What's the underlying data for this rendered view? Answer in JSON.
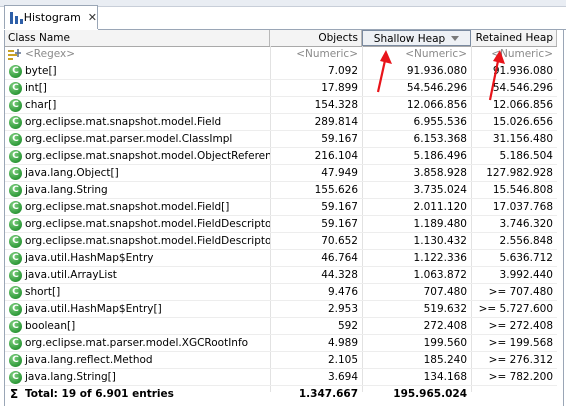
{
  "tab": {
    "title": "Histogram",
    "close": "✕"
  },
  "columns": {
    "class_name": "Class Name",
    "objects": "Objects",
    "shallow_heap": "Shallow Heap",
    "retained_heap": "Retained Heap"
  },
  "filter": {
    "regex": "<Regex>",
    "numeric1": "<Numeric>",
    "numeric2": "<Numeric>",
    "numeric3": "<Numeric>"
  },
  "rows": [
    {
      "name": "byte[]",
      "objects": "7.092",
      "shallow": "91.936.080",
      "retained": "91.936.080"
    },
    {
      "name": "int[]",
      "objects": "17.899",
      "shallow": "54.546.296",
      "retained": "54.546.296"
    },
    {
      "name": "char[]",
      "objects": "154.328",
      "shallow": "12.066.856",
      "retained": "12.066.856"
    },
    {
      "name": "org.eclipse.mat.snapshot.model.Field",
      "objects": "289.814",
      "shallow": "6.955.536",
      "retained": "15.026.656"
    },
    {
      "name": "org.eclipse.mat.parser.model.ClassImpl",
      "objects": "59.167",
      "shallow": "6.153.368",
      "retained": "31.156.480"
    },
    {
      "name": "org.eclipse.mat.snapshot.model.ObjectReference",
      "objects": "216.104",
      "shallow": "5.186.496",
      "retained": "5.186.504"
    },
    {
      "name": "java.lang.Object[]",
      "objects": "47.949",
      "shallow": "3.858.928",
      "retained": "127.982.928"
    },
    {
      "name": "java.lang.String",
      "objects": "155.626",
      "shallow": "3.735.024",
      "retained": "15.546.808"
    },
    {
      "name": "org.eclipse.mat.snapshot.model.Field[]",
      "objects": "59.167",
      "shallow": "2.011.120",
      "retained": "17.037.768"
    },
    {
      "name": "org.eclipse.mat.snapshot.model.FieldDescriptor[]",
      "objects": "59.167",
      "shallow": "1.189.480",
      "retained": "3.746.320"
    },
    {
      "name": "org.eclipse.mat.snapshot.model.FieldDescriptor",
      "objects": "70.652",
      "shallow": "1.130.432",
      "retained": "2.556.848"
    },
    {
      "name": "java.util.HashMap$Entry",
      "objects": "46.764",
      "shallow": "1.122.336",
      "retained": "5.636.712"
    },
    {
      "name": "java.util.ArrayList",
      "objects": "44.328",
      "shallow": "1.063.872",
      "retained": "3.992.440"
    },
    {
      "name": "short[]",
      "objects": "9.476",
      "shallow": "707.480",
      "retained": ">= 707.480"
    },
    {
      "name": "java.util.HashMap$Entry[]",
      "objects": "2.953",
      "shallow": "519.632",
      "retained": ">= 5.727.600"
    },
    {
      "name": "boolean[]",
      "objects": "592",
      "shallow": "272.408",
      "retained": ">= 272.408"
    },
    {
      "name": "org.eclipse.mat.parser.model.XGCRootInfo",
      "objects": "4.989",
      "shallow": "199.560",
      "retained": ">= 199.568"
    },
    {
      "name": "java.lang.reflect.Method",
      "objects": "2.105",
      "shallow": "185.240",
      "retained": ">= 276.312"
    },
    {
      "name": "java.lang.String[]",
      "objects": "3.694",
      "shallow": "134.168",
      "retained": ">= 782.200"
    }
  ],
  "total": {
    "label": "Total: 19 of 6.901 entries",
    "objects": "1.347.667",
    "shallow": "195.965.024",
    "sigma": "Σ"
  },
  "class_icon_letter": "C",
  "annotation_color": "#e8141a",
  "icons": {
    "tab": "histogram-icon",
    "class": "class-icon",
    "regex": "regex-filter-icon",
    "sort": "sort-descending-icon",
    "total": "sigma-icon"
  }
}
